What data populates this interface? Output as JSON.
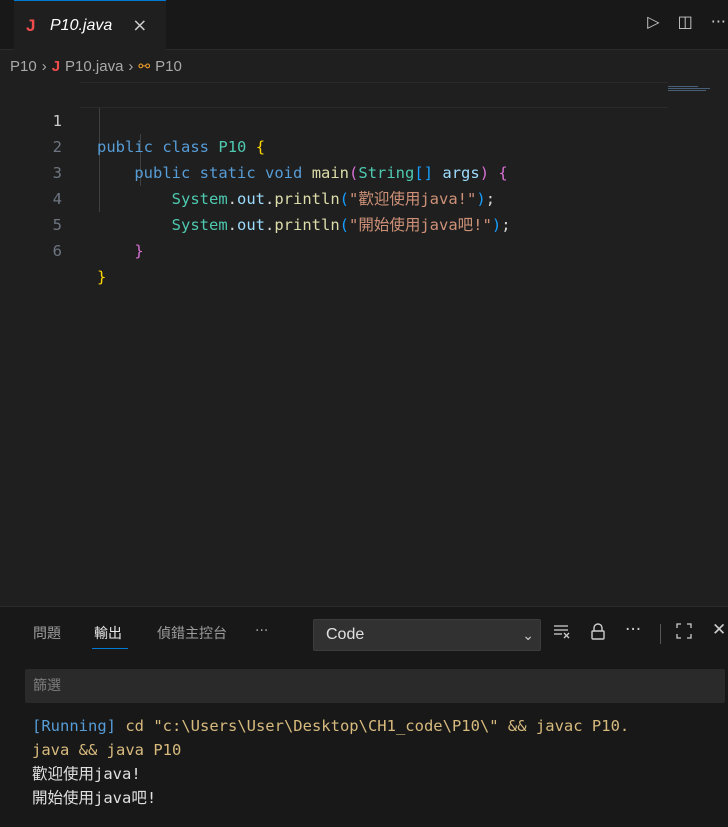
{
  "tab": {
    "icon": "java-file-icon",
    "title": "P10.java",
    "close": "×"
  },
  "tab_actions": {
    "run": "▷",
    "split": "◫",
    "more": "···"
  },
  "breadcrumb": {
    "folder": "P10",
    "file": "P10.java",
    "symbol": "P10"
  },
  "editor": {
    "lines": [
      {
        "num": "1",
        "active": true
      },
      {
        "num": "2"
      },
      {
        "num": "3"
      },
      {
        "num": "4"
      },
      {
        "num": "5"
      },
      {
        "num": "6"
      }
    ],
    "tokens": {
      "public": "public",
      "class": "class",
      "className": "P10",
      "static": "static",
      "void": "void",
      "main": "main",
      "String": "String",
      "brackets": "[]",
      "args": "args",
      "System": "System",
      "out": "out",
      "println": "println",
      "str1": "\"歡迎使用java!\"",
      "str2": "\"開始使用java吧!\""
    }
  },
  "panel": {
    "tabs": [
      {
        "label": "問題"
      },
      {
        "label": "輸出",
        "active": true
      },
      {
        "label": "偵錯主控台"
      },
      {
        "label": "···"
      }
    ],
    "source_select": "Code",
    "filter_placeholder": "篩選",
    "output": {
      "running_tag": "[Running]",
      "command_line1": " cd \"c:\\Users\\User\\Desktop\\CH1_code\\P10\\\" && javac P10.",
      "command_line2": "java && java P10",
      "lines": [
        "歡迎使用java!",
        "開始使用java吧!"
      ]
    }
  },
  "colors": {
    "accent": "#0078d4",
    "background": "#1f1f1f",
    "panel": "#181818"
  }
}
